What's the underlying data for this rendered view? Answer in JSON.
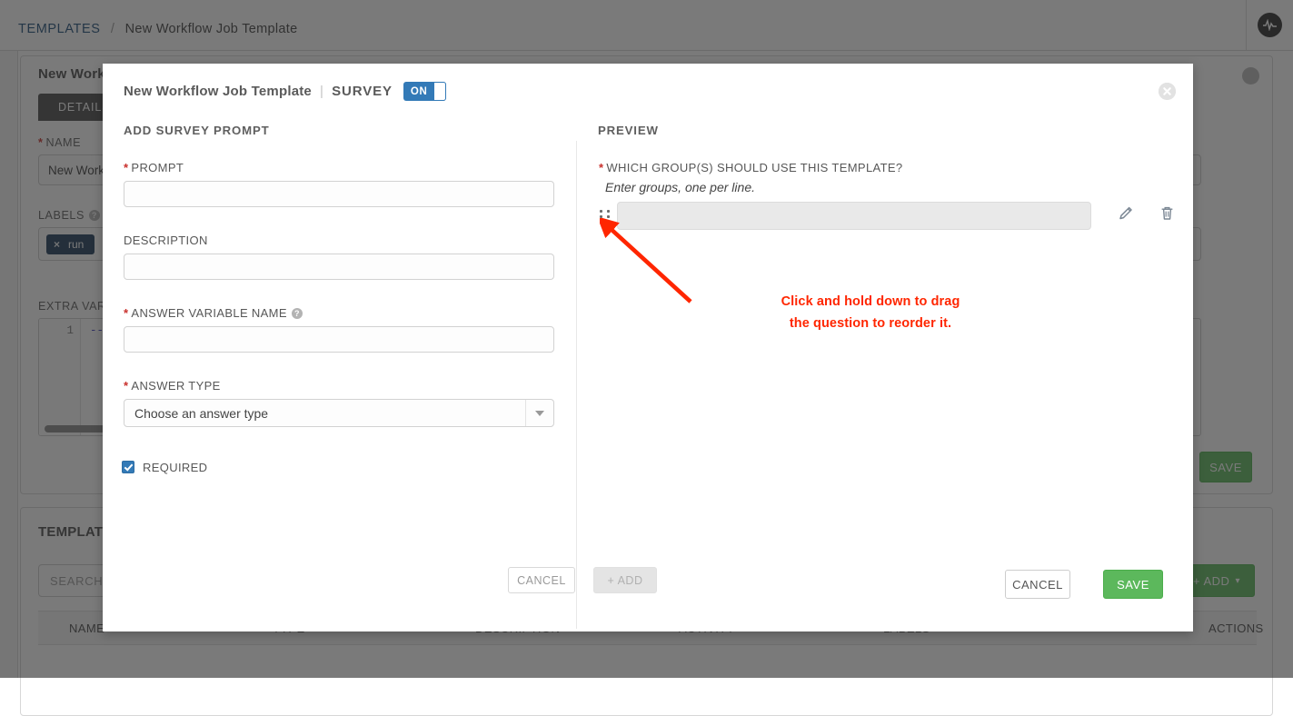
{
  "breadcrumb": {
    "root": "TEMPLATES",
    "separator": "/",
    "current": "New Workflow Job Template"
  },
  "topbar": {
    "pulse_icon": "activity-pulse-icon"
  },
  "background": {
    "detail_card": {
      "title": "New Workflow Job Template",
      "close_icon": "close-icon",
      "tab_details": "DETAILS",
      "name_label": "NAME",
      "name_value": "New Workflow Job Template",
      "labels_label": "LABELS",
      "label_chips": [
        {
          "remove": "×",
          "text": "run"
        }
      ],
      "extra_vars_label": "EXTRA VARIABLES",
      "code_line_number": "1",
      "code_line_text": "---",
      "save_label": "SAVE"
    },
    "list_card": {
      "title": "TEMPLATES",
      "search_placeholder": "SEARCH",
      "add_label": "+ ADD",
      "add_caret": "▾",
      "columns": [
        {
          "label": "NAME",
          "sort": "▲"
        },
        {
          "label": "TYPE",
          "sort": "▴▾"
        },
        {
          "label": "DESCRIPTION",
          "sort": "▴▾"
        },
        {
          "label": "ACTIVITY",
          "sort": ""
        },
        {
          "label": "LABELS",
          "sort": ""
        },
        {
          "label": "ACTIONS",
          "sort": ""
        }
      ]
    }
  },
  "modal": {
    "title_main": "New Workflow Job Template",
    "title_divider": "|",
    "title_section": "SURVEY",
    "toggle_state": "ON",
    "close_icon": "close-icon",
    "left": {
      "section_title": "ADD SURVEY PROMPT",
      "prompt_label": "PROMPT",
      "prompt_required": true,
      "prompt_value": "",
      "description_label": "DESCRIPTION",
      "description_value": "",
      "answer_variable_label": "ANSWER VARIABLE NAME",
      "answer_variable_help_icon": "help-circle-icon",
      "answer_variable_value": "",
      "answer_type_label": "ANSWER TYPE",
      "answer_type_value": "Choose an answer type",
      "answer_type_caret": "chevron-down-icon",
      "required_label": "REQUIRED",
      "required_checked": true,
      "cancel_label": "CANCEL",
      "add_label": "+ ADD"
    },
    "preview": {
      "section_title": "PREVIEW",
      "question_text": "WHICH GROUP(S) SHOULD USE THIS TEMPLATE?",
      "question_required": true,
      "question_description": "Enter groups, one per line.",
      "answer_value": "",
      "drag_handle_icon": "drag-handle-icon",
      "edit_icon": "pencil-icon",
      "delete_icon": "trash-icon"
    },
    "footer": {
      "cancel_label": "CANCEL",
      "save_label": "SAVE"
    }
  },
  "annotation": {
    "line1": "Click and hold down to drag",
    "line2": "the question to reorder it.",
    "color": "#ff2600",
    "arrow_icon": "arrow-pointer-icon"
  },
  "colors": {
    "accent_blue": "#337ab7",
    "link_blue": "#1f4e79",
    "green": "#5cb85c",
    "required_red": "#c9302c",
    "annotation_red": "#ff2600",
    "dim_overlay": "rgba(40,40,40,0.62)"
  }
}
